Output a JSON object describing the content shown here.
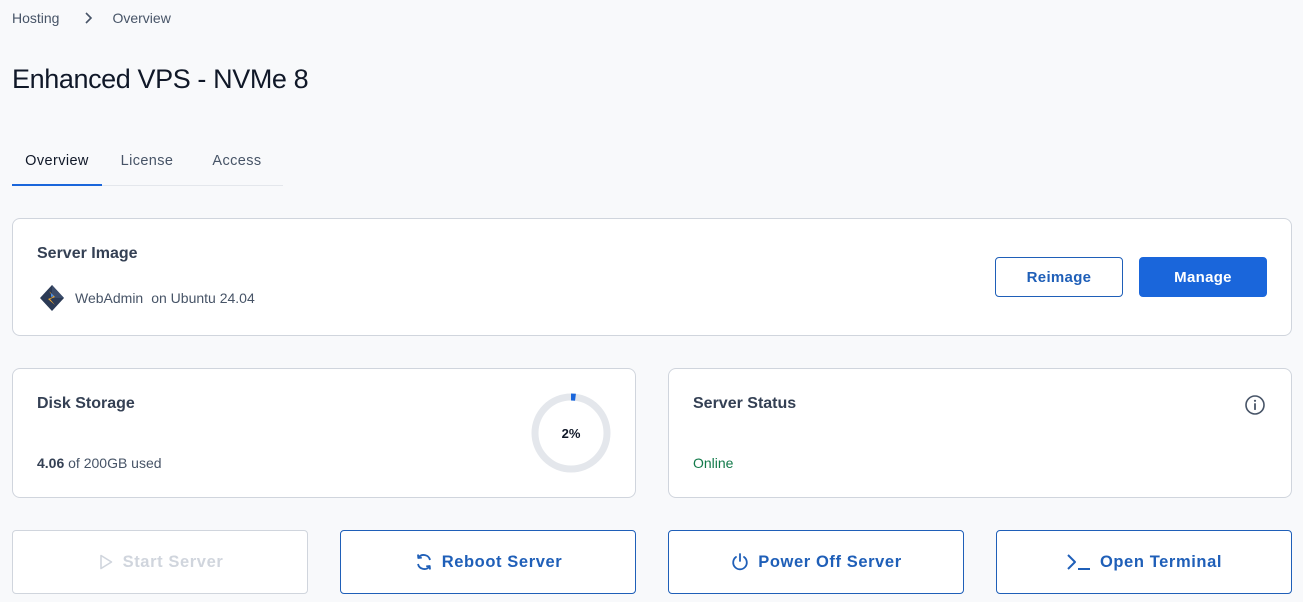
{
  "breadcrumb": {
    "root": "Hosting",
    "current": "Overview"
  },
  "page": {
    "title": "Enhanced VPS - NVMe 8"
  },
  "tabs": [
    {
      "label": "Overview",
      "active": true
    },
    {
      "label": "License",
      "active": false
    },
    {
      "label": "Access",
      "active": false
    }
  ],
  "server_image": {
    "title": "Server Image",
    "app_name": "WebAdmin",
    "os": "on Ubuntu 24.04",
    "reimage_label": "Reimage",
    "manage_label": "Manage"
  },
  "disk": {
    "title": "Disk Storage",
    "used": "4.06",
    "total_text": "of 200GB used",
    "percent_label": "2%",
    "percent": 2
  },
  "status": {
    "title": "Server Status",
    "value": "Online"
  },
  "actions": {
    "start": "Start Server",
    "reboot": "Reboot Server",
    "poweroff": "Power Off Server",
    "terminal": "Open Terminal"
  },
  "colors": {
    "accent": "#1a66db",
    "outline": "#1f5fb8",
    "status_online": "#127a4a",
    "donut_track": "#e4e7ec"
  }
}
